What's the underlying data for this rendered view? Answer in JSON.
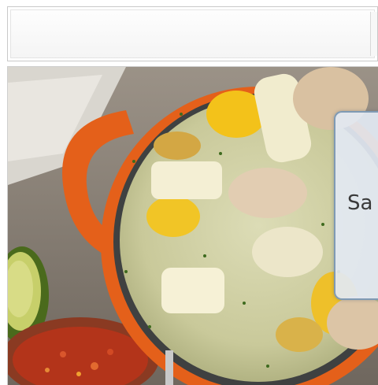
{
  "header": {
    "title": ""
  },
  "image": {
    "subject": "food-photo"
  },
  "overlay": {
    "partial_text": "Sa"
  },
  "colors": {
    "panel_border": "#7f9ab4",
    "panel_bg": "#e2e8f2",
    "pot": "#e4601a"
  }
}
